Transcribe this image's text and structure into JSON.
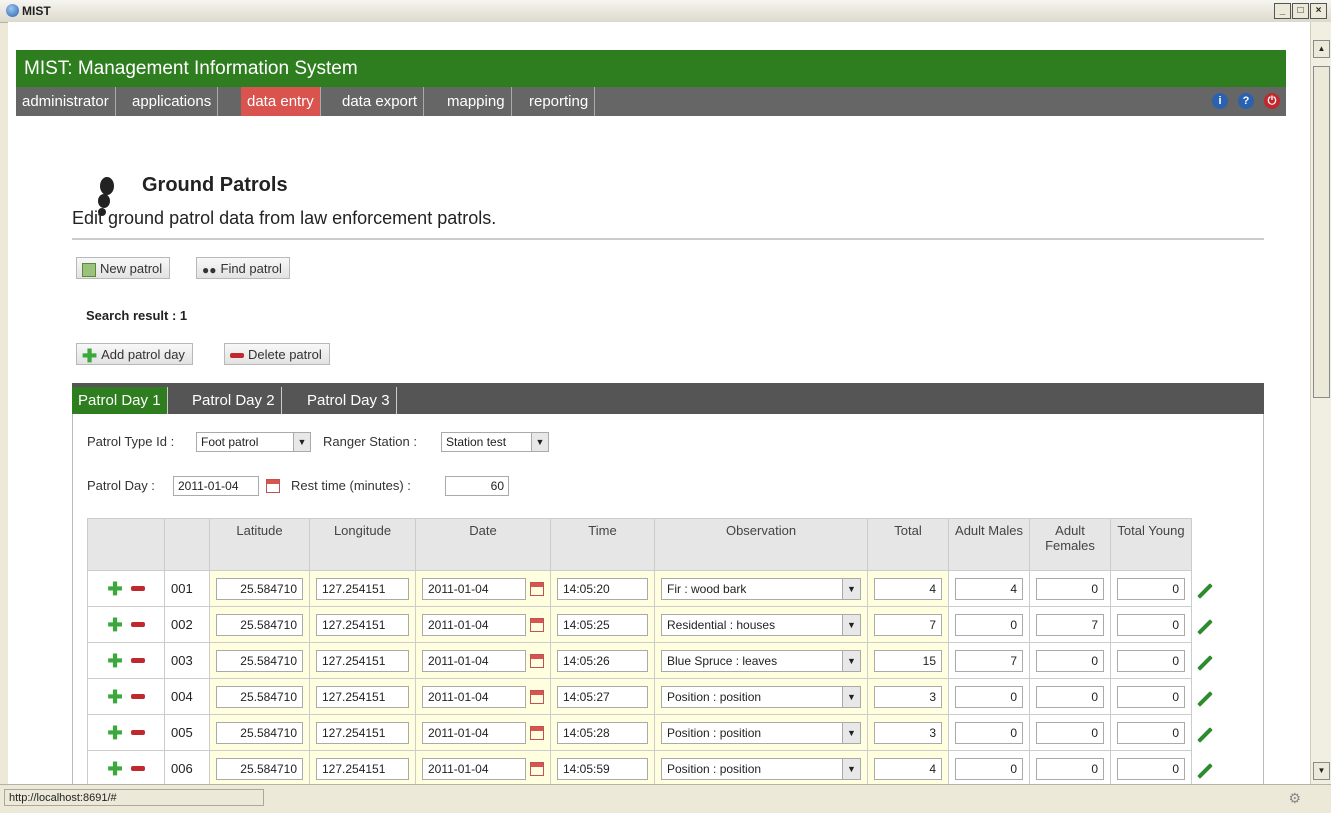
{
  "window": {
    "title": "MIST"
  },
  "app": {
    "header_title": "MIST: Management Information System",
    "menu": [
      "administrator",
      "applications",
      "data entry",
      "data export",
      "mapping",
      "reporting"
    ],
    "active_menu": "data entry"
  },
  "page": {
    "title": "Ground Patrols",
    "subtitle": "Edit ground patrol data from law enforcement patrols.",
    "new_patrol": "New patrol",
    "find_patrol": "Find patrol",
    "search_result": "Search result : 1",
    "add_patrol_day": "Add patrol day",
    "delete_patrol": "Delete patrol"
  },
  "tabs": [
    "Patrol Day 1",
    "Patrol Day 2",
    "Patrol Day 3"
  ],
  "form": {
    "patrol_type_label": "Patrol Type Id :",
    "patrol_type_value": "Foot patrol",
    "ranger_station_label": "Ranger Station :",
    "ranger_station_value": "Station test",
    "patrol_day_label": "Patrol Day :",
    "patrol_day_value": "2011-01-04",
    "rest_time_label": "Rest time (minutes) :",
    "rest_time_value": "60"
  },
  "table": {
    "headers": [
      "",
      "",
      "Latitude",
      "Longitude",
      "Date",
      "Time",
      "Observation",
      "Total",
      "Adult Males",
      "Adult Females",
      "Total Young"
    ],
    "rows": [
      {
        "id": "001",
        "lat": "25.584710",
        "lon": "127.254151",
        "date": "2011-01-04",
        "time": "14:05:20",
        "obs": "Fir : wood bark",
        "total": "4",
        "males": "4",
        "females": "0",
        "young": "0"
      },
      {
        "id": "002",
        "lat": "25.584710",
        "lon": "127.254151",
        "date": "2011-01-04",
        "time": "14:05:25",
        "obs": "Residential : houses",
        "total": "7",
        "males": "0",
        "females": "7",
        "young": "0"
      },
      {
        "id": "003",
        "lat": "25.584710",
        "lon": "127.254151",
        "date": "2011-01-04",
        "time": "14:05:26",
        "obs": "Blue Spruce : leaves",
        "total": "15",
        "males": "7",
        "females": "0",
        "young": "0"
      },
      {
        "id": "004",
        "lat": "25.584710",
        "lon": "127.254151",
        "date": "2011-01-04",
        "time": "14:05:27",
        "obs": "Position : position",
        "total": "3",
        "males": "0",
        "females": "0",
        "young": "0"
      },
      {
        "id": "005",
        "lat": "25.584710",
        "lon": "127.254151",
        "date": "2011-01-04",
        "time": "14:05:28",
        "obs": "Position : position",
        "total": "3",
        "males": "0",
        "females": "0",
        "young": "0"
      },
      {
        "id": "006",
        "lat": "25.584710",
        "lon": "127.254151",
        "date": "2011-01-04",
        "time": "14:05:59",
        "obs": "Position : position",
        "total": "4",
        "males": "0",
        "females": "0",
        "young": "0"
      }
    ]
  },
  "status": {
    "url": "http://localhost:8691/#"
  },
  "colors": {
    "header_green": "#2e7d1e",
    "active_menu_red": "#d9534f",
    "menu_gray": "#666666"
  }
}
